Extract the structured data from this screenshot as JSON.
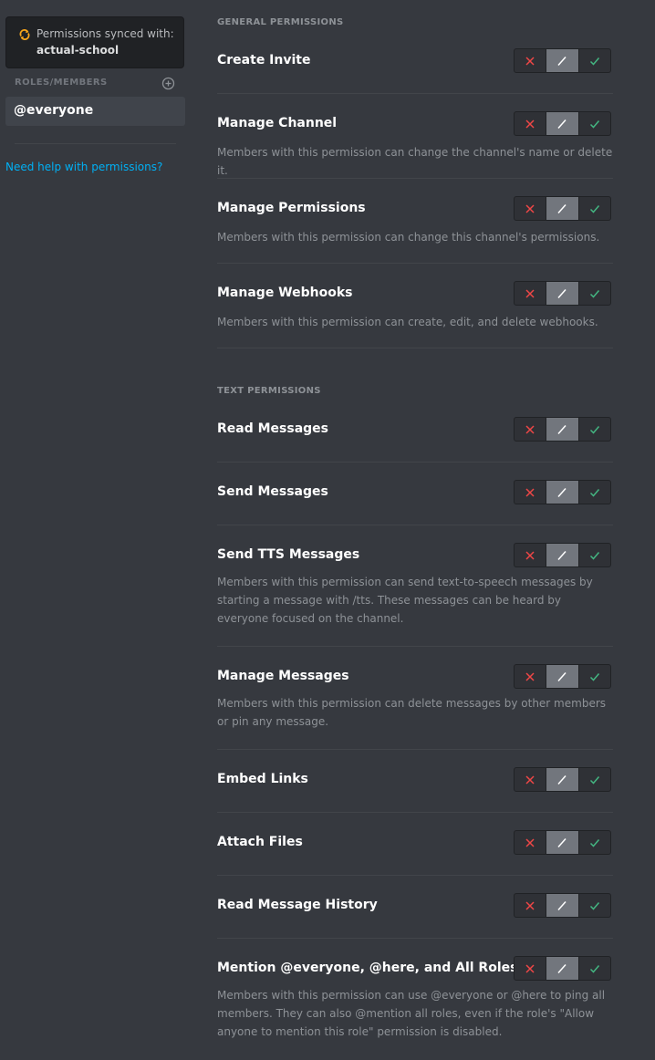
{
  "sidebar": {
    "sync_label": "Permissions synced with:",
    "sync_category": "actual-school",
    "roles_header": "ROLES/MEMBERS",
    "roles": [
      {
        "label": "@everyone",
        "selected": true
      }
    ],
    "help_link": "Need help with permissions?"
  },
  "sections": [
    {
      "header": "GENERAL PERMISSIONS"
    },
    {
      "header": "TEXT PERMISSIONS"
    }
  ],
  "permissions": [
    {
      "title": "Create Invite",
      "description": "",
      "state": "inherit"
    },
    {
      "title": "Manage Channel",
      "description": "Members with this permission can change the channel's name or delete it.",
      "state": "inherit"
    },
    {
      "title": "Manage Permissions",
      "description": "Members with this permission can change this channel's permissions.",
      "state": "inherit"
    },
    {
      "title": "Manage Webhooks",
      "description": "Members with this permission can create, edit, and delete webhooks.",
      "state": "inherit"
    },
    {
      "title": "Read Messages",
      "description": "",
      "state": "inherit"
    },
    {
      "title": "Send Messages",
      "description": "",
      "state": "inherit"
    },
    {
      "title": "Send TTS Messages",
      "description": "Members with this permission can send text-to-speech messages by starting a message with /tts. These messages can be heard by everyone focused on the channel.",
      "state": "inherit"
    },
    {
      "title": "Manage Messages",
      "description": "Members with this permission can delete messages by other members or pin any message.",
      "state": "inherit"
    },
    {
      "title": "Embed Links",
      "description": "",
      "state": "inherit"
    },
    {
      "title": "Attach Files",
      "description": "",
      "state": "inherit"
    },
    {
      "title": "Read Message History",
      "description": "",
      "state": "inherit"
    },
    {
      "title": "Mention @everyone, @here, and All Roles",
      "description": "Members with this permission can use @everyone or @here to ping all members. They can also @mention all roles, even if the role's \"Allow anyone to mention this role\" permission is disabled.",
      "state": "inherit"
    }
  ],
  "toggle_icons": {
    "deny": "x-icon",
    "pass": "slash-icon",
    "allow": "check-icon"
  },
  "colors": {
    "deny": "#f04747",
    "allow": "#43b581",
    "pass_bg": "#72767d",
    "sync_icon": "#faa61a",
    "link": "#00b0f4"
  }
}
